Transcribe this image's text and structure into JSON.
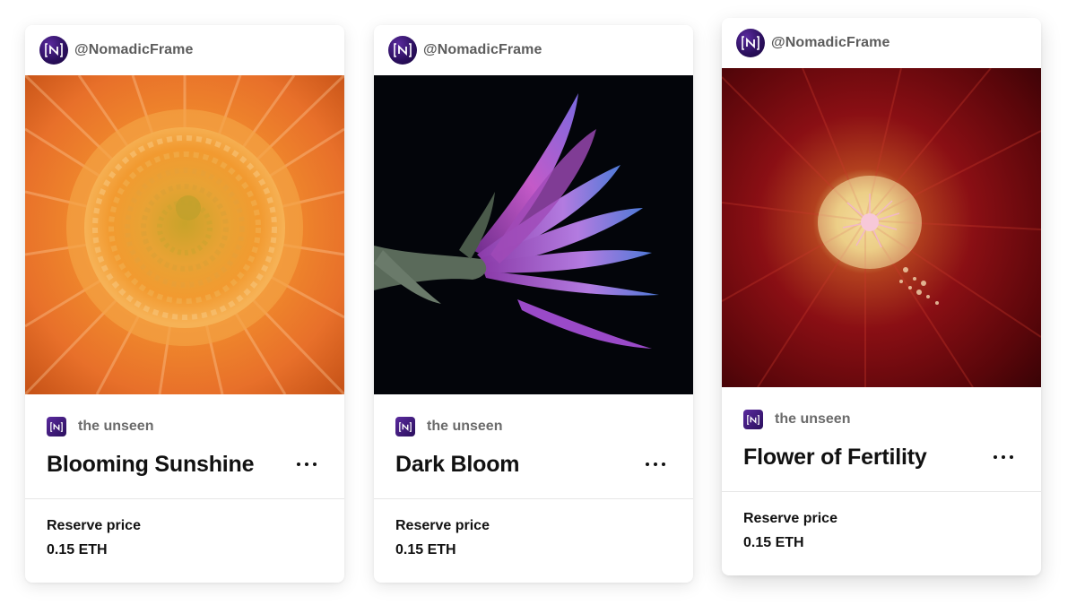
{
  "cards": [
    {
      "creator_handle": "@NomadicFrame",
      "collection_name": "the unseen",
      "title": "Blooming Sunshine",
      "price_label": "Reserve price",
      "price_value": "0.15 ETH",
      "image_subject": "orange-gerbera-flower-closeup"
    },
    {
      "creator_handle": "@NomadicFrame",
      "collection_name": "the unseen",
      "title": "Dark Bloom",
      "price_label": "Reserve price",
      "price_value": "0.15 ETH",
      "image_subject": "purple-flower-on-black-background"
    },
    {
      "creator_handle": "@NomadicFrame",
      "collection_name": "the unseen",
      "title": "Flower of Fertility",
      "price_label": "Reserve price",
      "price_value": "0.15 ETH",
      "image_subject": "red-hollyhock-flower-center"
    }
  ],
  "colors": {
    "brand_purple": "#2a0f5c",
    "muted_text": "#5c5c5c",
    "divider": "#e6e6e6"
  }
}
